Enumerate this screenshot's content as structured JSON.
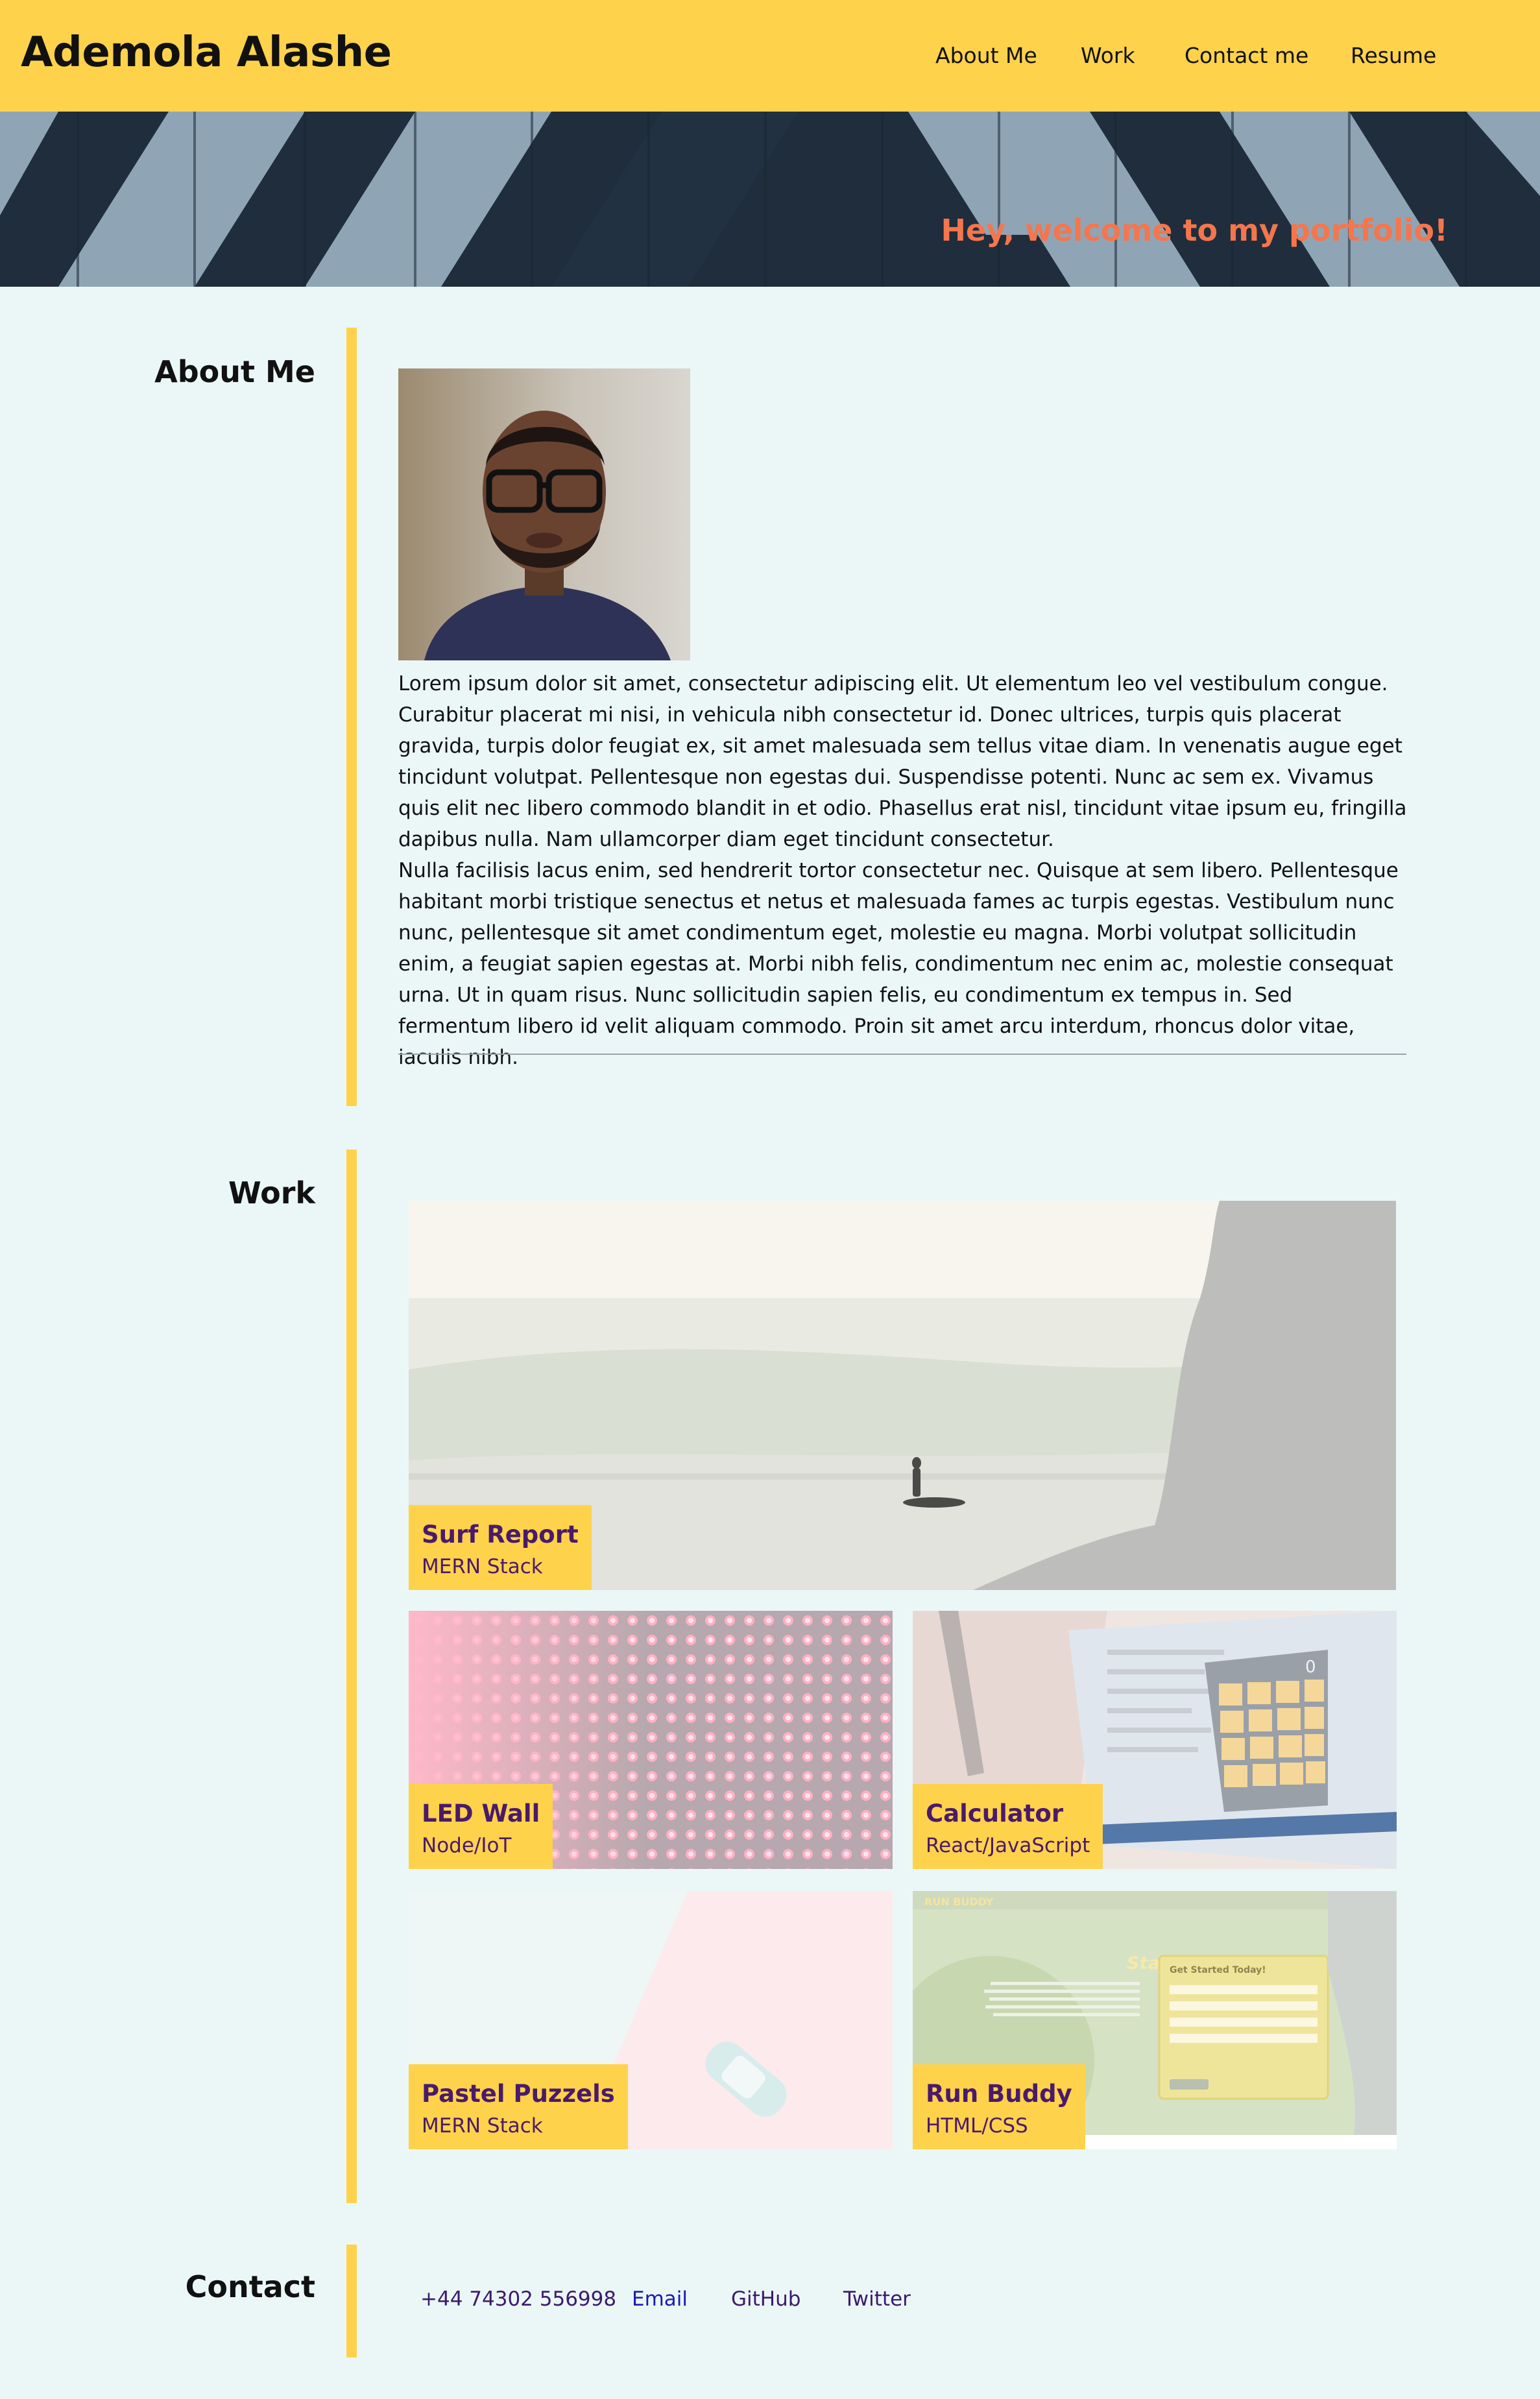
{
  "header": {
    "title": "Ademola Alashe",
    "nav": [
      "About Me",
      "Work",
      "Contact me",
      "Resume"
    ]
  },
  "hero": {
    "tagline": "Hey, welcome to my portfolio!"
  },
  "about": {
    "heading": "About Me",
    "paragraphs": [
      "Lorem ipsum dolor sit amet, consectetur adipiscing elit. Ut elementum leo vel vestibulum congue. Curabitur placerat mi nisi, in vehicula nibh consectetur id. Donec ultrices, turpis quis placerat gravida, turpis dolor feugiat ex, sit amet malesuada sem tellus vitae diam. In venenatis augue eget tincidunt volutpat. Pellentesque non egestas dui. Suspendisse potenti. Nunc ac sem ex. Vivamus quis elit nec libero commodo blandit in et odio. Phasellus erat nisl, tincidunt vitae ipsum eu, fringilla dapibus nulla. Nam ullamcorper diam eget tincidunt consectetur.",
      "Nulla facilisis lacus enim, sed hendrerit tortor consectetur nec. Quisque at sem libero. Pellentesque habitant morbi tristique senectus et netus et malesuada fames ac turpis egestas. Vestibulum nunc nunc, pellentesque sit amet condimentum eget, molestie eu magna. Morbi volutpat sollicitudin enim, a feugiat sapien egestas at. Morbi nibh felis, condimentum nec enim ac, molestie consequat urna. Ut in quam risus. Nunc sollicitudin sapien felis, eu condimentum ex tempus in. Sed fermentum libero id velit aliquam commodo. Proin sit amet arcu interdum, rhoncus dolor vitae, iaculis nibh."
    ]
  },
  "work": {
    "heading": "Work",
    "projects": [
      {
        "title": "Surf Report",
        "stack": "MERN Stack"
      },
      {
        "title": "LED Wall",
        "stack": "Node/IoT"
      },
      {
        "title": "Calculator",
        "stack": "React/JavaScript"
      },
      {
        "title": "Pastel Puzzels",
        "stack": "MERN Stack"
      },
      {
        "title": "Run Buddy",
        "stack": "HTML/CSS"
      }
    ],
    "calculator_display": "0",
    "run_buddy_preview": {
      "brand": "RUN BUDDY",
      "headline": "Start Building Habits.",
      "form_title": "Get Started Today!"
    }
  },
  "contact": {
    "heading": "Contact",
    "links": [
      {
        "label": "+44 74302 556998",
        "color": "#3b1a6e"
      },
      {
        "label": "Email",
        "color": "#1a1ab8"
      },
      {
        "label": "GitHub",
        "color": "#3b1a6e"
      },
      {
        "label": "Twitter",
        "color": "#3b1a6e"
      }
    ]
  },
  "colors": {
    "accent": "#ffd24c",
    "background": "#ebf7f7",
    "tagline": "#f4764d",
    "card_text": "#4a1a6a"
  }
}
